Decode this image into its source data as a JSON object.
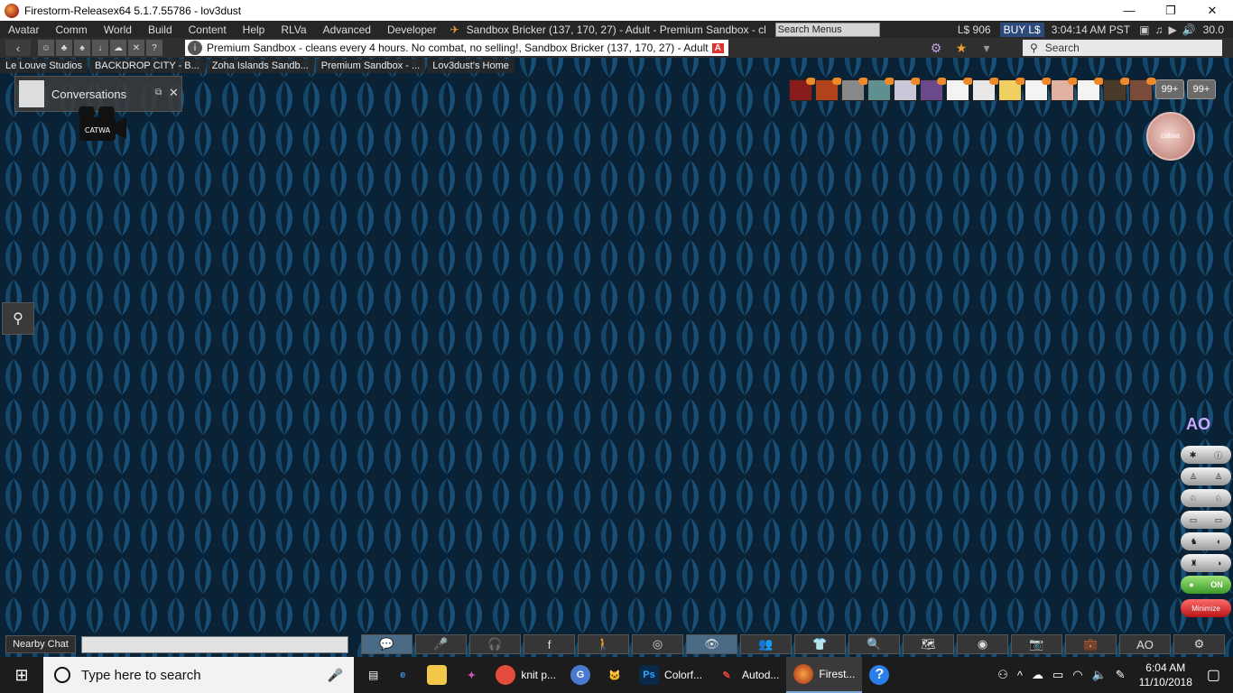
{
  "window": {
    "title": "Firestorm-Releasex64 5.1.7.55786 - lov3dust",
    "minimize": "—",
    "restore": "❐",
    "close": "✕"
  },
  "menubar": {
    "menus": [
      "Avatar",
      "Comm",
      "World",
      "Build",
      "Content",
      "Help",
      "RLVa",
      "Advanced",
      "Developer"
    ],
    "location": "Sandbox Bricker (137, 170, 27) - Adult - Premium Sandbox - cl",
    "search_menus_placeholder": "Search Menus",
    "balance": "L$ 906",
    "buy_label": "BUY L$",
    "clock": "3:04:14 AM PST",
    "fps": "30.0"
  },
  "navbar": {
    "location_text": "Premium Sandbox - cleans every 4 hours. No combat, no selling!, Sandbox Bricker (137, 170, 27) - Adult",
    "rating_badge": "A",
    "search_placeholder": "Search"
  },
  "favorites": [
    "Le Louve Studios",
    "BACKDROP CITY - B...",
    "Zoha Islands Sandb...",
    "Premium Sandbox - ...",
    "Lov3dust's Home"
  ],
  "conversations": {
    "title": "Conversations"
  },
  "notifications": {
    "colors": [
      "#8a1c1c",
      "#b2441b",
      "#888888",
      "#5f8f8f",
      "#c8c8d8",
      "#6a4a8a",
      "#f4f4f4",
      "#e8e8e8",
      "#f0d060",
      "#f4f4f4",
      "#e0b0a0",
      "#f4f4f4",
      "#4a3a2a",
      "#7a4a3a"
    ],
    "count_1": "99+",
    "count_2": "99+"
  },
  "hud": {
    "label": "catwa"
  },
  "ao": {
    "title": "AO",
    "on_label": "ON",
    "minimize_label": "Minimize"
  },
  "chat": {
    "nearby_label": "Nearby Chat"
  },
  "toolbar": {
    "ao_label": "AO"
  },
  "taskbar": {
    "search_placeholder": "Type here to search",
    "apps": [
      {
        "name": "Chrome",
        "label": "knit p..."
      },
      {
        "name": "Photoshop",
        "label": "Colorf..."
      },
      {
        "name": "Autodesk",
        "label": "Autod..."
      },
      {
        "name": "Firestorm",
        "label": "Firest..."
      }
    ],
    "time": "6:04 AM",
    "date": "11/10/2018"
  }
}
